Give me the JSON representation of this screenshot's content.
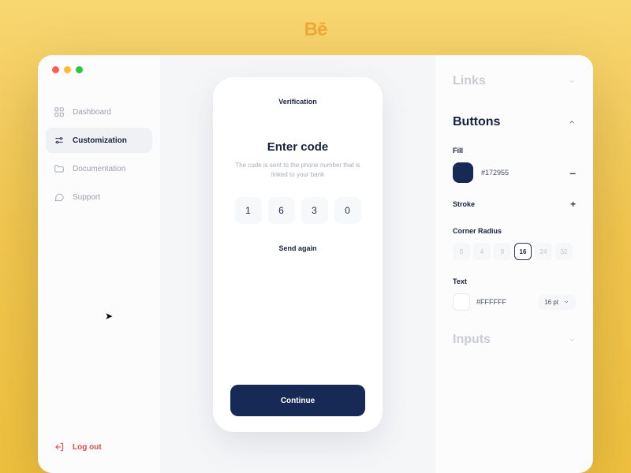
{
  "brand": "Bē",
  "sidebar": {
    "items": [
      {
        "label": "Dashboard"
      },
      {
        "label": "Customization"
      },
      {
        "label": "Documentation"
      },
      {
        "label": "Support"
      }
    ],
    "logout": "Log out"
  },
  "preview": {
    "title": "Verification",
    "heading": "Enter code",
    "description": "The code is sent to the phone number that is linked to your bank",
    "code": [
      "1",
      "6",
      "3",
      "0"
    ],
    "send_again": "Send again",
    "continue": "Continue"
  },
  "panel": {
    "links": {
      "title": "Links"
    },
    "buttons": {
      "title": "Buttons",
      "fill": {
        "label": "Fill",
        "hex": "#172955"
      },
      "stroke": {
        "label": "Stroke"
      },
      "corner_radius": {
        "label": "Corner Radius",
        "options": [
          "0",
          "4",
          "8",
          "16",
          "24",
          "32"
        ],
        "selected": "16"
      },
      "text": {
        "label": "Text",
        "hex": "#FFFFFF",
        "font_size": "16 pt"
      }
    },
    "inputs": {
      "title": "Inputs"
    }
  }
}
